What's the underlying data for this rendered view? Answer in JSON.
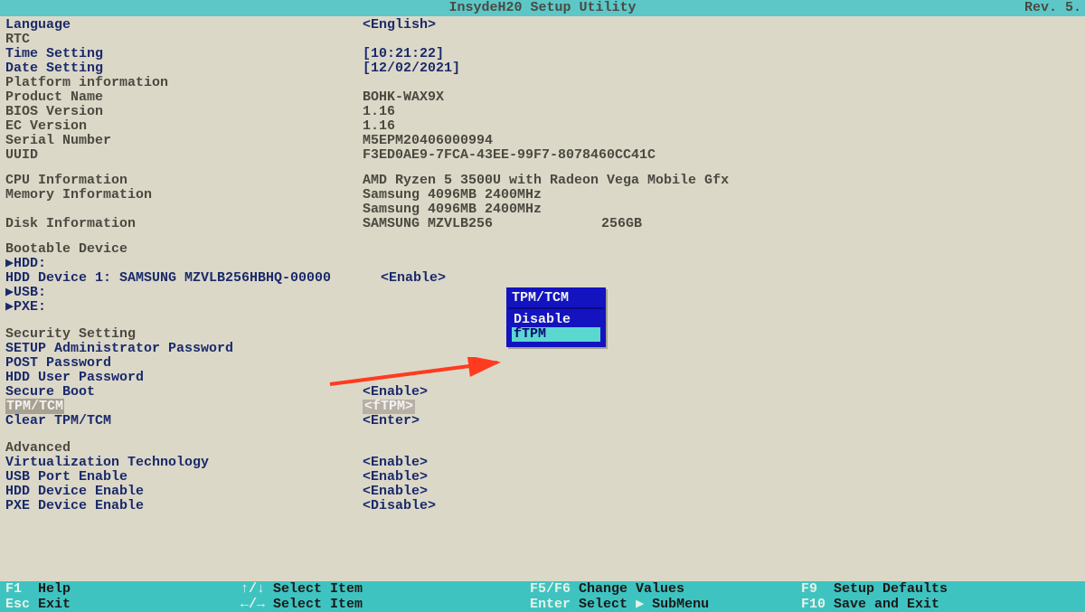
{
  "header": {
    "title": "InsydeH20 Setup Utility",
    "revision": "Rev. 5."
  },
  "main": {
    "language": {
      "label": "Language",
      "value": "<English>"
    },
    "rtc": "RTC",
    "time": {
      "label": "Time Setting",
      "value": "[10:21:22]"
    },
    "date": {
      "label": "Date Setting",
      "value": "[12/02/2021]"
    },
    "platform": "Platform information",
    "product": {
      "label": "Product Name",
      "value": "BOHK-WAX9X"
    },
    "bios": {
      "label": "BIOS Version",
      "value": "1.16"
    },
    "ec": {
      "label": "EC Version",
      "value": "1.16"
    },
    "serial": {
      "label": "Serial Number",
      "value": "M5EPM20406000994"
    },
    "uuid": {
      "label": "UUID",
      "value": "F3ED0AE9-7FCA-43EE-99F7-8078460CC41C"
    },
    "cpu": {
      "label": "CPU Information",
      "value": "AMD Ryzen 5 3500U with Radeon Vega Mobile Gfx"
    },
    "mem": {
      "label": "Memory Information",
      "value1": "Samsung 4096MB 2400MHz",
      "value2": "Samsung 4096MB 2400MHz"
    },
    "disk": {
      "label": "Disk Information",
      "value_left": "SAMSUNG MZVLB256",
      "value_right": "256GB"
    },
    "bootable": "Bootable Device",
    "hdd": "▶HDD:",
    "hdd1": {
      "label": "HDD Device 1: SAMSUNG MZVLB256HBHQ-00000",
      "value": "<Enable>"
    },
    "usb": "▶USB:",
    "pxe": "▶PXE:",
    "security": "Security Setting",
    "setup_pw": "SETUP Administrator Password",
    "post_pw": "POST Password",
    "hdd_pw": "HDD User Password",
    "secure_boot": {
      "label": "Secure Boot",
      "value": "<Enable>"
    },
    "tpm": {
      "label": "TPM/TCM",
      "value": "<fTPM>"
    },
    "clear_tpm": {
      "label": "Clear TPM/TCM",
      "value": "<Enter>"
    },
    "advanced": "Advanced",
    "virt": {
      "label": "Virtualization Technology",
      "value": "<Enable>"
    },
    "usb_port": {
      "label": "USB Port Enable",
      "value": "<Enable>"
    },
    "hdd_en": {
      "label": "HDD Device Enable",
      "value": "<Enable>"
    },
    "pxe_en": {
      "label": "PXE Device Enable",
      "value": "<Disable>"
    }
  },
  "popup": {
    "title": "TPM/TCM",
    "opt1": "Disable",
    "opt2": "fTPM"
  },
  "footer": {
    "r1c1k": "F1",
    "r1c1d": "Help",
    "r1c2k": "↑/↓",
    "r1c2d": "Select Item",
    "r1c3k": "F5/F6",
    "r1c3d": "Change Values",
    "r1c4k": "F9",
    "r1c4d": "Setup Defaults",
    "r2c1k": "Esc",
    "r2c1d": "Exit",
    "r2c2k": "←/→",
    "r2c2d": "Select Item",
    "r2c3k": "Enter",
    "r2c3d1": "Select",
    "r2c3arrow": "▶",
    "r2c3d2": "SubMenu",
    "r2c4k": "F10",
    "r2c4d": "Save and Exit"
  }
}
